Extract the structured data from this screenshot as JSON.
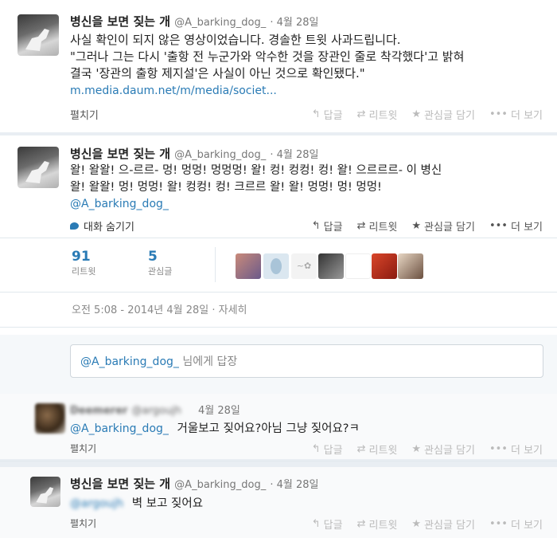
{
  "tweet1": {
    "name": "병신을 보면 짖는 개",
    "handle": "@A_barking_dog_",
    "date": "· 4월 28일",
    "text": "사실 확인이 되지 않은 영상이었습니다. 경솔한 트윗 사과드립니다.\n\"그러나 그는 다시 '출항 전 누군가와 악수한 것을 장관인 줄로 착각했다'고 밝혀\n결국 '장관의 출항 제지설'은 사실이 아닌 것으로 확인됐다.\"",
    "link": "m.media.daum.net/m/media/societ...",
    "expand": "펼치기"
  },
  "tweet2": {
    "name": "병신을 보면 짖는 개",
    "handle": "@A_barking_dog_",
    "date": "· 4월 28일",
    "text": "왈! 왈왈! 으-르르- 멍! 멍멍! 멍멍멍! 왈! 컹! 컹컹! 컹! 왈! 으르르르- 이 병신\n왈! 왈왈! 멍! 멍멍! 왈! 컹컹! 컹! 크르르 왈! 왈! 멍멍! 멍! 멍멍!",
    "mention": "@A_barking_dog_",
    "hide_conversation": "대화 숨기기",
    "retweets": "91",
    "retweets_label": "리트윗",
    "favorites": "5",
    "favorites_label": "관심글",
    "timestamp": "오전 5:08 - 2014년 4월 28일 · 자세히"
  },
  "actions": {
    "reply": "답글",
    "retweet": "리트윗",
    "favorite": "관심글 담기",
    "more": "더 보기"
  },
  "reply_box": {
    "mention": "@A_barking_dog_",
    "suffix": "님에게 답장"
  },
  "tweet3": {
    "name": "Deemerer",
    "handle": "@argoujh",
    "date": "4월 28일",
    "mention": "@A_barking_dog_",
    "text": "거울보고 짖어요?아님 그냥 짖어요?ㅋ",
    "expand": "펼치기"
  },
  "tweet4": {
    "name": "병신을 보면 짖는 개",
    "handle": "@A_barking_dog_",
    "date": "· 4월 28일",
    "mention": "@argoujh",
    "text": "벽 보고 짖어요",
    "expand": "펼치기"
  },
  "icons": {
    "reply": "reply-icon",
    "retweet": "retweet-icon",
    "favorite": "star-icon",
    "more": "more-icon",
    "conversation": "speech-bubble-icon"
  },
  "colors": {
    "link": "#2a7bb5",
    "background": "#e9eef3"
  }
}
